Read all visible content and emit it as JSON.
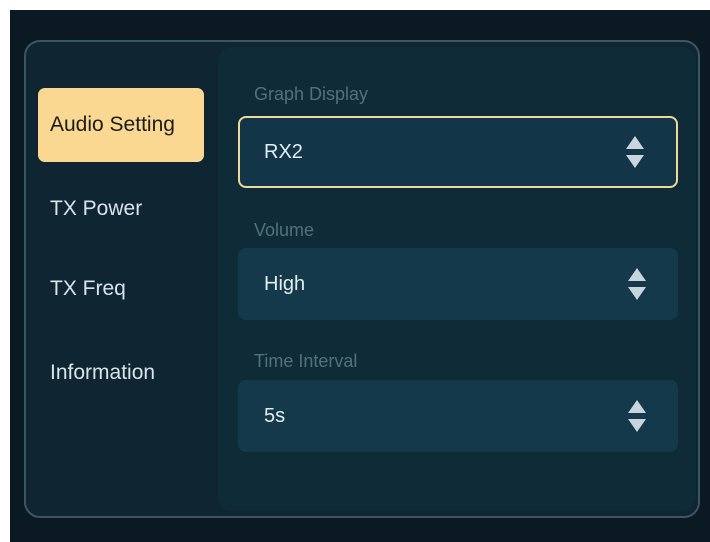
{
  "sidebar": {
    "items": [
      {
        "label": "Audio Setting",
        "active": true
      },
      {
        "label": "TX Power",
        "active": false
      },
      {
        "label": "TX Freq",
        "active": false
      },
      {
        "label": "Information",
        "active": false
      }
    ]
  },
  "settings": {
    "graph_display": {
      "label": "Graph Display",
      "value": "RX2"
    },
    "volume": {
      "label": "Volume",
      "value": "High"
    },
    "time_interval": {
      "label": "Time Interval",
      "value": "5s"
    }
  },
  "icons": {
    "select_arrows": "sort-up-down-icon"
  },
  "colors": {
    "accent": "#fad892",
    "focus_border": "#f0d79b",
    "background": "#0b1923",
    "panel": "#102532",
    "field": "#13394b"
  }
}
